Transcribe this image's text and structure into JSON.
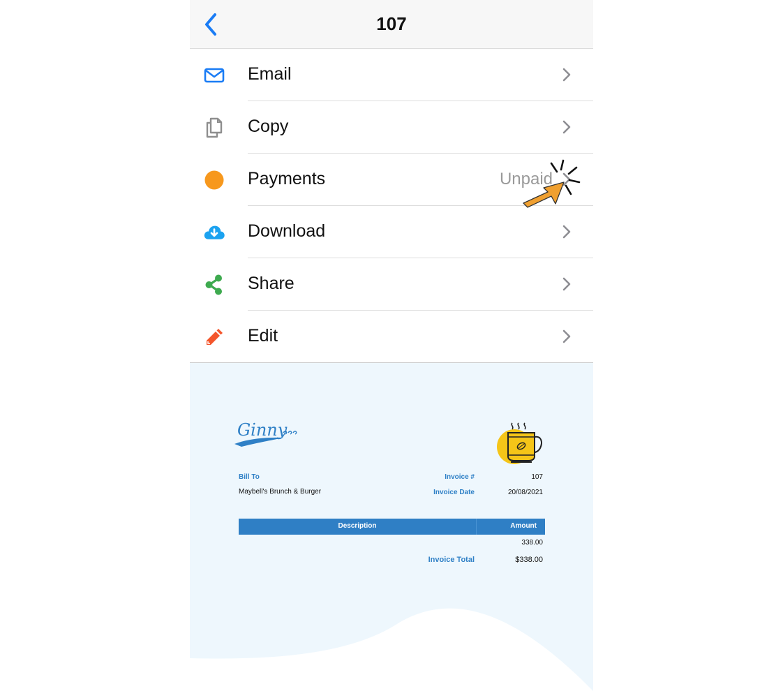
{
  "navbar": {
    "title": "107",
    "back_icon": "chevron-left-icon"
  },
  "menu": {
    "items": [
      {
        "id": "email",
        "label": "Email",
        "icon": "envelope-icon",
        "value": ""
      },
      {
        "id": "copy",
        "label": "Copy",
        "icon": "copy-icon",
        "value": ""
      },
      {
        "id": "payments",
        "label": "Payments",
        "icon": "orange-dot-icon",
        "value": "Unpaid"
      },
      {
        "id": "download",
        "label": "Download",
        "icon": "cloud-download-icon",
        "value": ""
      },
      {
        "id": "share",
        "label": "Share",
        "icon": "share-icon",
        "value": ""
      },
      {
        "id": "edit",
        "label": "Edit",
        "icon": "pencil-icon",
        "value": ""
      }
    ]
  },
  "colors": {
    "accent_blue": "#2f80c6",
    "ios_blue": "#1a7cf5",
    "payments_orange": "#f7981d",
    "download_cyan": "#1ba2f0",
    "share_green": "#3eaa4f",
    "edit_red": "#f4552b",
    "preview_bg": "#eef7fd",
    "cursor_orange": "#f0a030"
  },
  "invoice": {
    "brand": "Ginny",
    "bill_to_label": "Bill To",
    "bill_to_name": "Maybell's Brunch & Burger",
    "invoice_no_label": "Invoice #",
    "invoice_no": "107",
    "invoice_date_label": "Invoice Date",
    "invoice_date": "20/08/2021",
    "table": {
      "headers": [
        "Description",
        "Amount"
      ],
      "rows": [
        {
          "description": "",
          "amount": "338.00"
        }
      ]
    },
    "total_label": "Invoice Total",
    "total_value": "$338.00"
  }
}
